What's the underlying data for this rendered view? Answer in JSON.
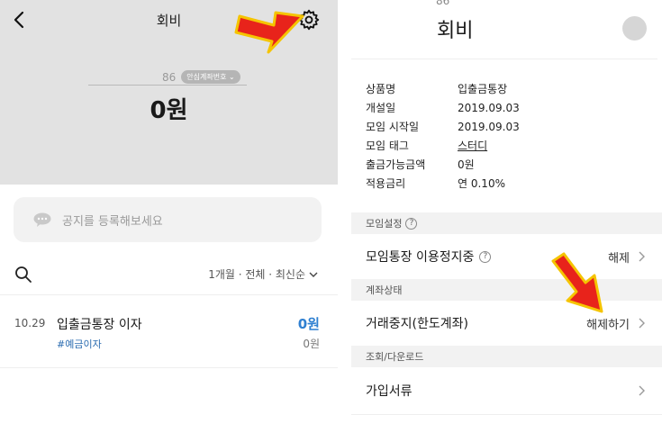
{
  "left": {
    "header": {
      "title": "회비"
    },
    "account": {
      "number": "86",
      "badge": "안심계좌번호"
    },
    "balance": "0원",
    "notice": {
      "placeholder": "공지를 등록해보세요"
    },
    "filter": {
      "label": "1개월 · 전체 · 최신순"
    },
    "transactions": [
      {
        "date": "10.29",
        "title": "입출금통장 이자",
        "tag": "#예금이자",
        "amount": "0원",
        "balance": "0원"
      }
    ]
  },
  "right": {
    "top_number": "86",
    "title": "회비",
    "info": [
      {
        "key": "상품명",
        "value": "입출금통장"
      },
      {
        "key": "개설일",
        "value": "2019.09.03"
      },
      {
        "key": "모임 시작일",
        "value": "2019.09.03"
      },
      {
        "key": "모임 태그",
        "value": "스터디"
      },
      {
        "key": "출금가능금액",
        "value": "0원"
      },
      {
        "key": "적용금리",
        "value": "연 0.10%"
      }
    ],
    "sections": {
      "meeting_settings": "모임설정",
      "account_status": "계좌상태",
      "lookup": "조회/다운로드"
    },
    "rows": {
      "suspend": {
        "label": "모임통장 이용정지중",
        "value": "해제"
      },
      "halt": {
        "label": "거래중지(한도계좌)",
        "value": "해제하기"
      },
      "docs": {
        "label": "가입서류"
      }
    }
  },
  "colors": {
    "accent_blue": "#2f80d1",
    "annotation_red": "#e8231b",
    "annotation_yellow": "#f5c400"
  },
  "icons": [
    "back-icon",
    "gear-icon",
    "chat-bubble-icon",
    "search-icon",
    "chevron-down-icon",
    "help-icon",
    "chevron-right-icon"
  ]
}
